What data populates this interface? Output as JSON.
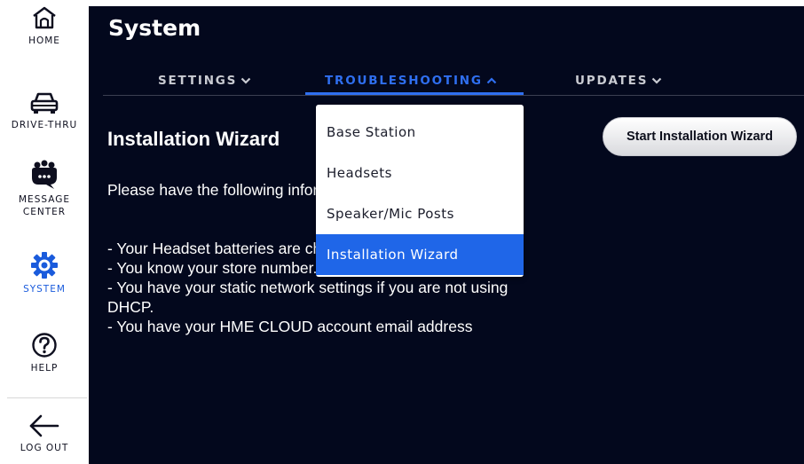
{
  "sidebar": {
    "items": [
      {
        "label": "HOME",
        "icon": "home-icon",
        "active": false
      },
      {
        "label": "DRIVE-THRU",
        "icon": "car-icon",
        "active": false
      },
      {
        "label": "MESSAGE\nCENTER",
        "icon": "message-center-icon",
        "active": false
      },
      {
        "label": "SYSTEM",
        "icon": "gear-icon",
        "active": true
      },
      {
        "label": "HELP",
        "icon": "help-icon",
        "active": false
      },
      {
        "label": "LOG OUT",
        "icon": "arrow-left-icon",
        "active": false
      }
    ]
  },
  "page": {
    "title": "System"
  },
  "tabs": [
    {
      "label": "SETTINGS",
      "expanded": false
    },
    {
      "label": "TROUBLESHOOTING",
      "expanded": true
    },
    {
      "label": "UPDATES",
      "expanded": false
    }
  ],
  "dropdown": {
    "items": [
      "Base Station",
      "Headsets",
      "Speaker/Mic Posts",
      "Installation Wizard"
    ],
    "selected": "Installation Wizard"
  },
  "content": {
    "section_title": "Installation Wizard",
    "paragraph": "Please have the following information ready before starting:",
    "checklist": [
      "- Your Headset batteries are charged.",
      "- You know your store number.",
      "- You have your static network settings if you are not using DHCP.",
      "- You have your HME CLOUD account email address"
    ],
    "start_button": "Start Installation Wizard"
  },
  "colors": {
    "panel": "#03081d",
    "accent": "#2f6ff0",
    "selected_item": "#1f66e8",
    "sidebar_text": "#0e0f1f"
  }
}
